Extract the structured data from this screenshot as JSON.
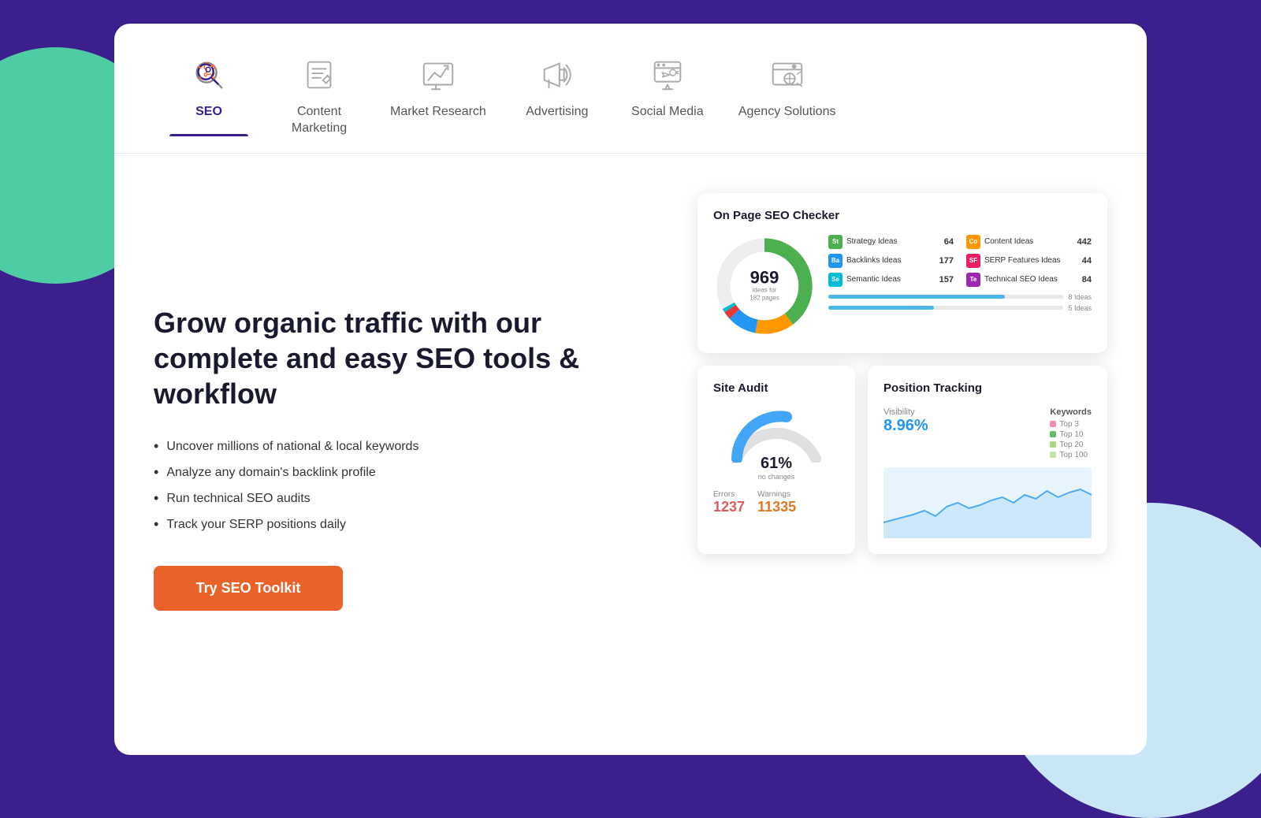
{
  "background": {
    "mainColor": "#3b1f8c"
  },
  "tabs": [
    {
      "id": "seo",
      "label": "SEO",
      "active": true
    },
    {
      "id": "content",
      "label": "Content\nMarketing",
      "active": false
    },
    {
      "id": "market",
      "label": "Market Research",
      "active": false
    },
    {
      "id": "advertising",
      "label": "Advertising",
      "active": false
    },
    {
      "id": "social",
      "label": "Social Media",
      "active": false
    },
    {
      "id": "agency",
      "label": "Agency Solutions",
      "active": false
    }
  ],
  "hero": {
    "headline": "Grow organic traffic with our complete and easy SEO tools & workflow",
    "features": [
      "Uncover millions of national & local keywords",
      "Analyze any domain's backlink profile",
      "Run technical SEO audits",
      "Track your SERP positions daily"
    ],
    "cta_label": "Try SEO Toolkit"
  },
  "seo_checker": {
    "title": "On Page SEO Checker",
    "total": "969",
    "subtitle": "ideas for\n182 pages",
    "ideas": [
      {
        "badge": "St",
        "color": "#4caf50",
        "label": "Strategy Ideas",
        "count": "64"
      },
      {
        "badge": "Co",
        "color": "#ff9800",
        "label": "Content Ideas",
        "count": "442"
      },
      {
        "badge": "Ba",
        "color": "#2196f3",
        "label": "Backlinks Ideas",
        "count": "177"
      },
      {
        "badge": "SF",
        "color": "#e91e63",
        "label": "SERP Features Ideas",
        "count": "44"
      },
      {
        "badge": "Se",
        "color": "#00bcd4",
        "label": "Semantic Ideas",
        "count": "157"
      },
      {
        "badge": "Te",
        "color": "#9c27b0",
        "label": "Technical SEO Ideas",
        "count": "84"
      }
    ],
    "progress_bars": [
      {
        "label": "8 Ideas",
        "pct": 75
      },
      {
        "label": "5 Ideas",
        "pct": 45
      }
    ]
  },
  "site_audit": {
    "title": "Site Audit",
    "gauge_pct": 61,
    "gauge_label": "61%",
    "gauge_subtitle": "no changes",
    "errors_label": "Errors",
    "errors_value": "1237",
    "warnings_label": "Warnings",
    "warnings_value": "11335"
  },
  "position_tracking": {
    "title": "Position Tracking",
    "visibility_label": "Visibility",
    "visibility_value": "8.96%",
    "keywords_label": "Keywords",
    "legend": [
      {
        "label": "Top 3",
        "color": "#f48fb1"
      },
      {
        "label": "Top 10",
        "color": "#a5d6a7"
      },
      {
        "label": "Top 20",
        "color": "#c5e1a5"
      },
      {
        "label": "Top 100",
        "color": "#aed6ae"
      }
    ]
  }
}
